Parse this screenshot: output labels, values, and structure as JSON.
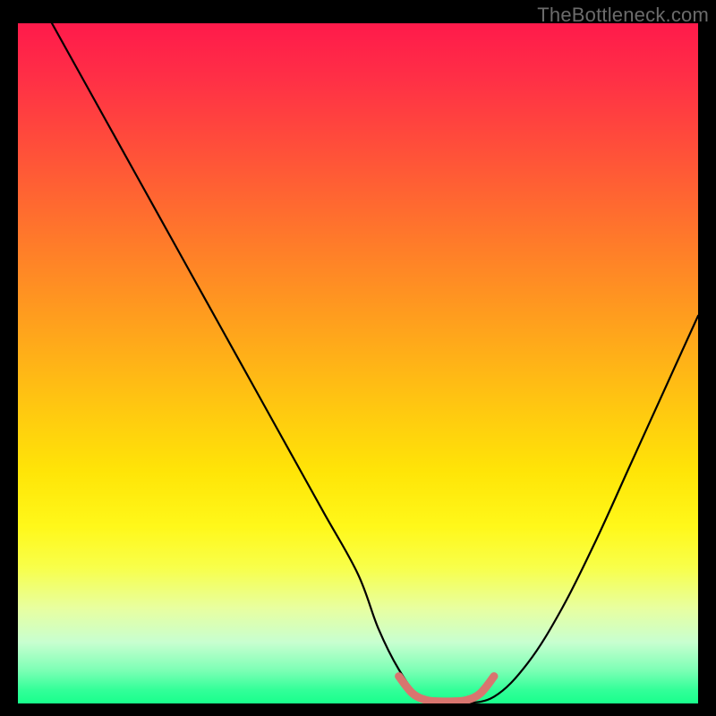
{
  "watermark": "TheBottleneck.com",
  "colors": {
    "background": "#000000",
    "curve": "#000000",
    "highlight": "#d8756f"
  },
  "chart_data": {
    "type": "line",
    "title": "",
    "xlabel": "",
    "ylabel": "",
    "xlim": [
      0,
      100
    ],
    "ylim": [
      0,
      100
    ],
    "grid": false,
    "legend": false,
    "series": [
      {
        "name": "curve",
        "x": [
          5,
          10,
          15,
          20,
          25,
          30,
          35,
          40,
          45,
          50,
          53,
          56,
          59,
          62,
          65,
          70,
          75,
          80,
          85,
          90,
          95,
          100
        ],
        "y": [
          100,
          91,
          82,
          73,
          64,
          55,
          46,
          37,
          28,
          19,
          11,
          5,
          1,
          0,
          0,
          1,
          6,
          14,
          24,
          35,
          46,
          57
        ]
      },
      {
        "name": "highlight",
        "x": [
          56,
          58,
          60,
          62,
          64,
          66,
          68,
          70
        ],
        "y": [
          4,
          1.5,
          0.5,
          0.3,
          0.3,
          0.5,
          1.5,
          4
        ]
      }
    ]
  }
}
